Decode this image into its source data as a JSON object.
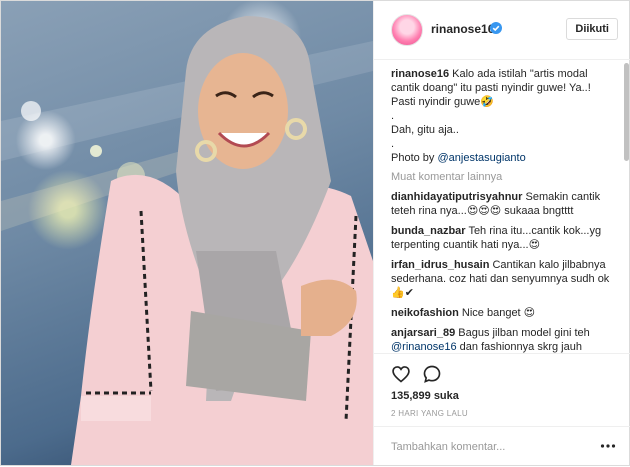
{
  "header": {
    "username": "rinanose16",
    "follow_label": "Diikuti"
  },
  "caption": {
    "username": "rinanose16",
    "line1": "Kalo ada istilah \"artis modal cantik doang\" itu pasti nyindir guwe! Ya..! Pasti nyindir guwe🤣",
    "dot1": ".",
    "line2": "Dah, gitu aja..",
    "dot2": ".",
    "photo_prefix": "Photo by ",
    "photo_mention": "@anjestasugianto"
  },
  "more_comments_label": "Muat komentar lainnya",
  "comments": [
    {
      "username": "dianhidayatiputrisyahnur",
      "text": "Semakin cantik teteh rina nya...😍😍😍 sukaaa bngtttt"
    },
    {
      "username": "bunda_nazbar",
      "text": "Teh rina itu...cantik kok...yg terpenting cuantik hati nya...😍"
    },
    {
      "username": "irfan_idrus_husain",
      "text": "Cantikan kalo jilbabnya sederhana. coz hati dan senyumnya sudh ok 👍✔"
    },
    {
      "username": "neikofashion",
      "text": "Nice banget 😍"
    },
    {
      "username": "anjarsari_89",
      "text": "Bagus jilban model gini teh ",
      "mention": "@rinanose16",
      "text_after": " dan fashionnya skrg jauh"
    }
  ],
  "likes_label": "135,899 suka",
  "timestamp": "2 HARI YANG LALU",
  "add_comment_placeholder": "Tambahkan komentar...",
  "icons": {
    "verified": "verified-badge-icon",
    "heart": "heart-outline-icon",
    "comment": "speech-bubble-icon",
    "more": "ellipsis-icon"
  },
  "colors": {
    "verified_blue": "#3897f0",
    "mention_blue": "#003569",
    "muted_gray": "#999999",
    "border": "#dbdbdb"
  }
}
